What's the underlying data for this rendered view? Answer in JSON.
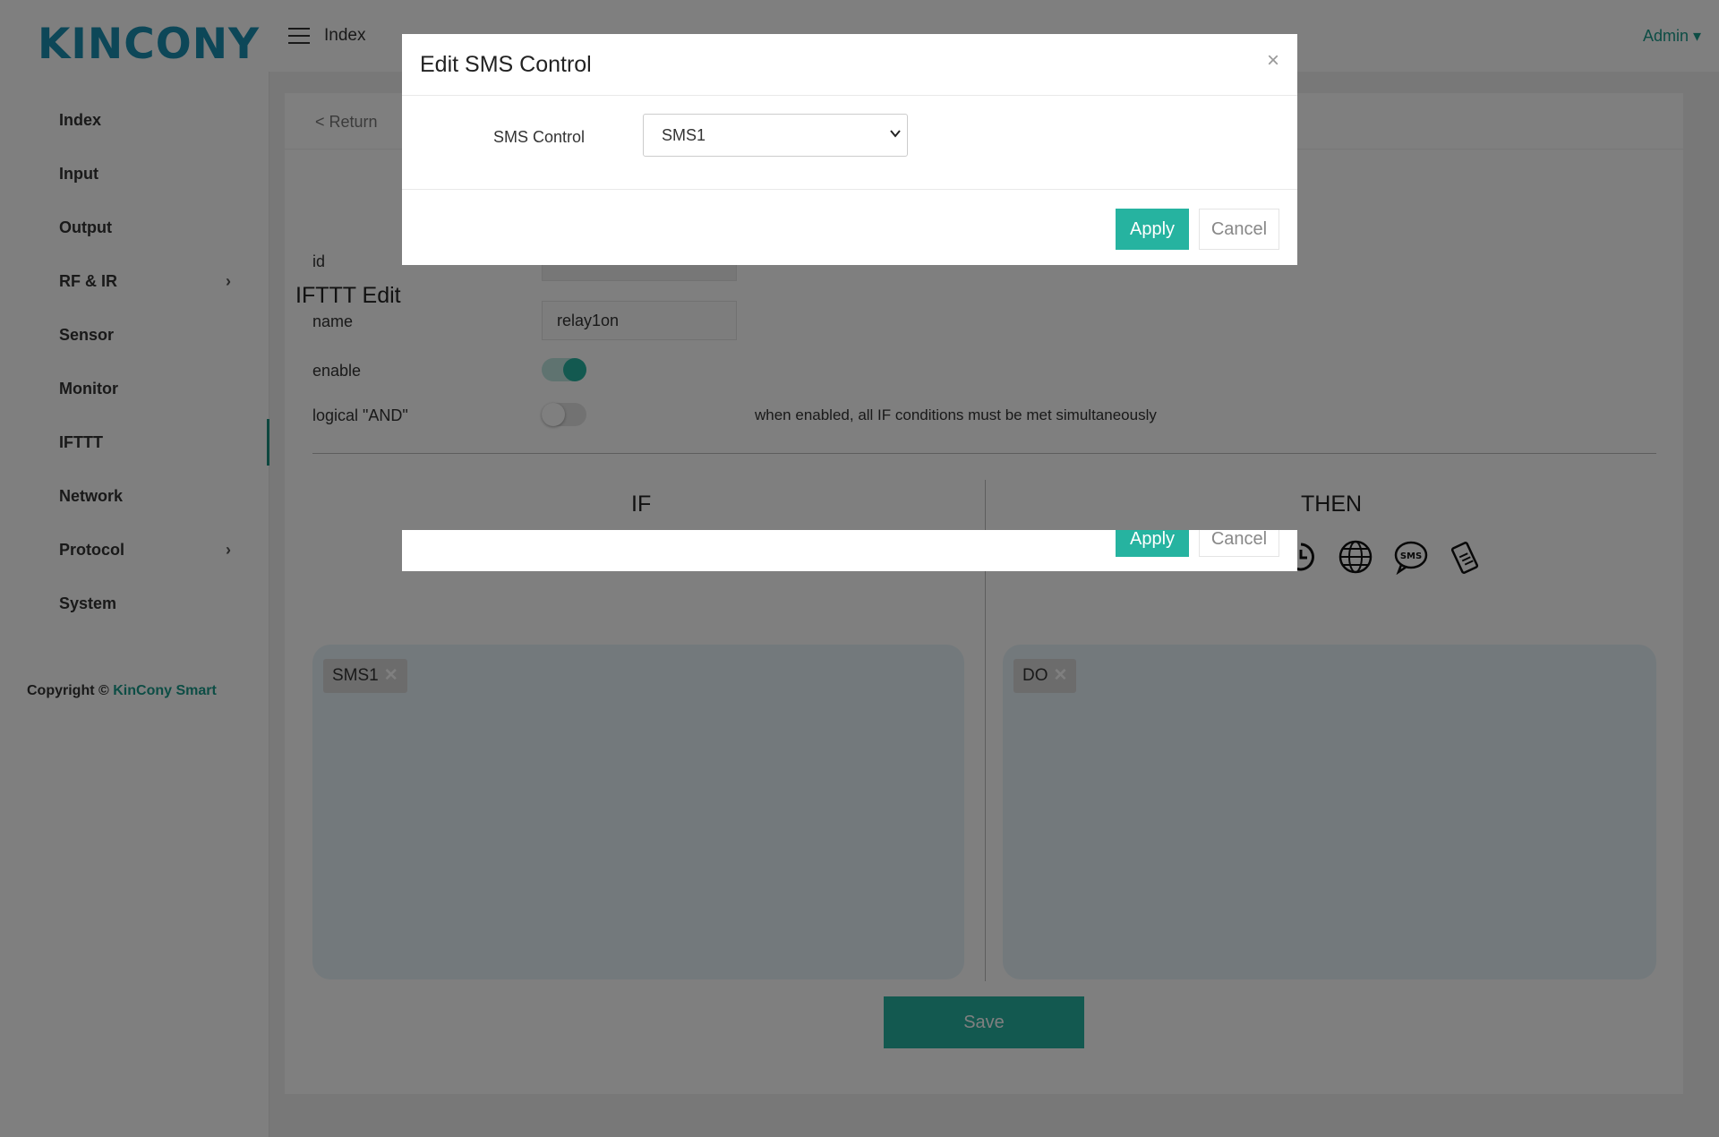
{
  "app": {
    "logo": "KINCONY",
    "header_title": "Index",
    "user": "Admin ▾"
  },
  "sidebar": {
    "items": [
      {
        "label": "Index"
      },
      {
        "label": "Input"
      },
      {
        "label": "Output"
      },
      {
        "label": "RF & IR",
        "has_submenu": true
      },
      {
        "label": "Sensor"
      },
      {
        "label": "Monitor"
      },
      {
        "label": "IFTTT",
        "active": true
      },
      {
        "label": "Network"
      },
      {
        "label": "Protocol",
        "has_submenu": true
      },
      {
        "label": "System"
      }
    ],
    "copyright_prefix": "Copyright © ",
    "copyright_link": "KinCony Smart"
  },
  "page": {
    "return_label": "< Return",
    "title": "IFTTT Edit",
    "fields": {
      "id_label": "id",
      "name_label": "name",
      "name_value": "relay1on",
      "enable_label": "enable",
      "enable_on": true,
      "and_label": "logical \"AND\"",
      "and_on": false,
      "and_hint": "when enabled, all IF conditions must be met simultaneously"
    },
    "if_heading": "IF",
    "then_heading": "THEN",
    "then_icons": [
      "timer-icon",
      "globe-icon",
      "sms-icon",
      "phone-icon"
    ],
    "if_chip": "SMS1",
    "then_chip": "DO",
    "chip_remove": "✕",
    "save_label": "Save"
  },
  "modal": {
    "title": "Edit SMS Control",
    "close": "×",
    "field_label": "SMS Control",
    "select_value": "SMS1",
    "apply_label": "Apply",
    "cancel_label": "Cancel"
  },
  "colors": {
    "accent": "#26b3a0",
    "logo": "#1a8fb0",
    "overlay": "rgba(0,0,0,0.5)"
  }
}
